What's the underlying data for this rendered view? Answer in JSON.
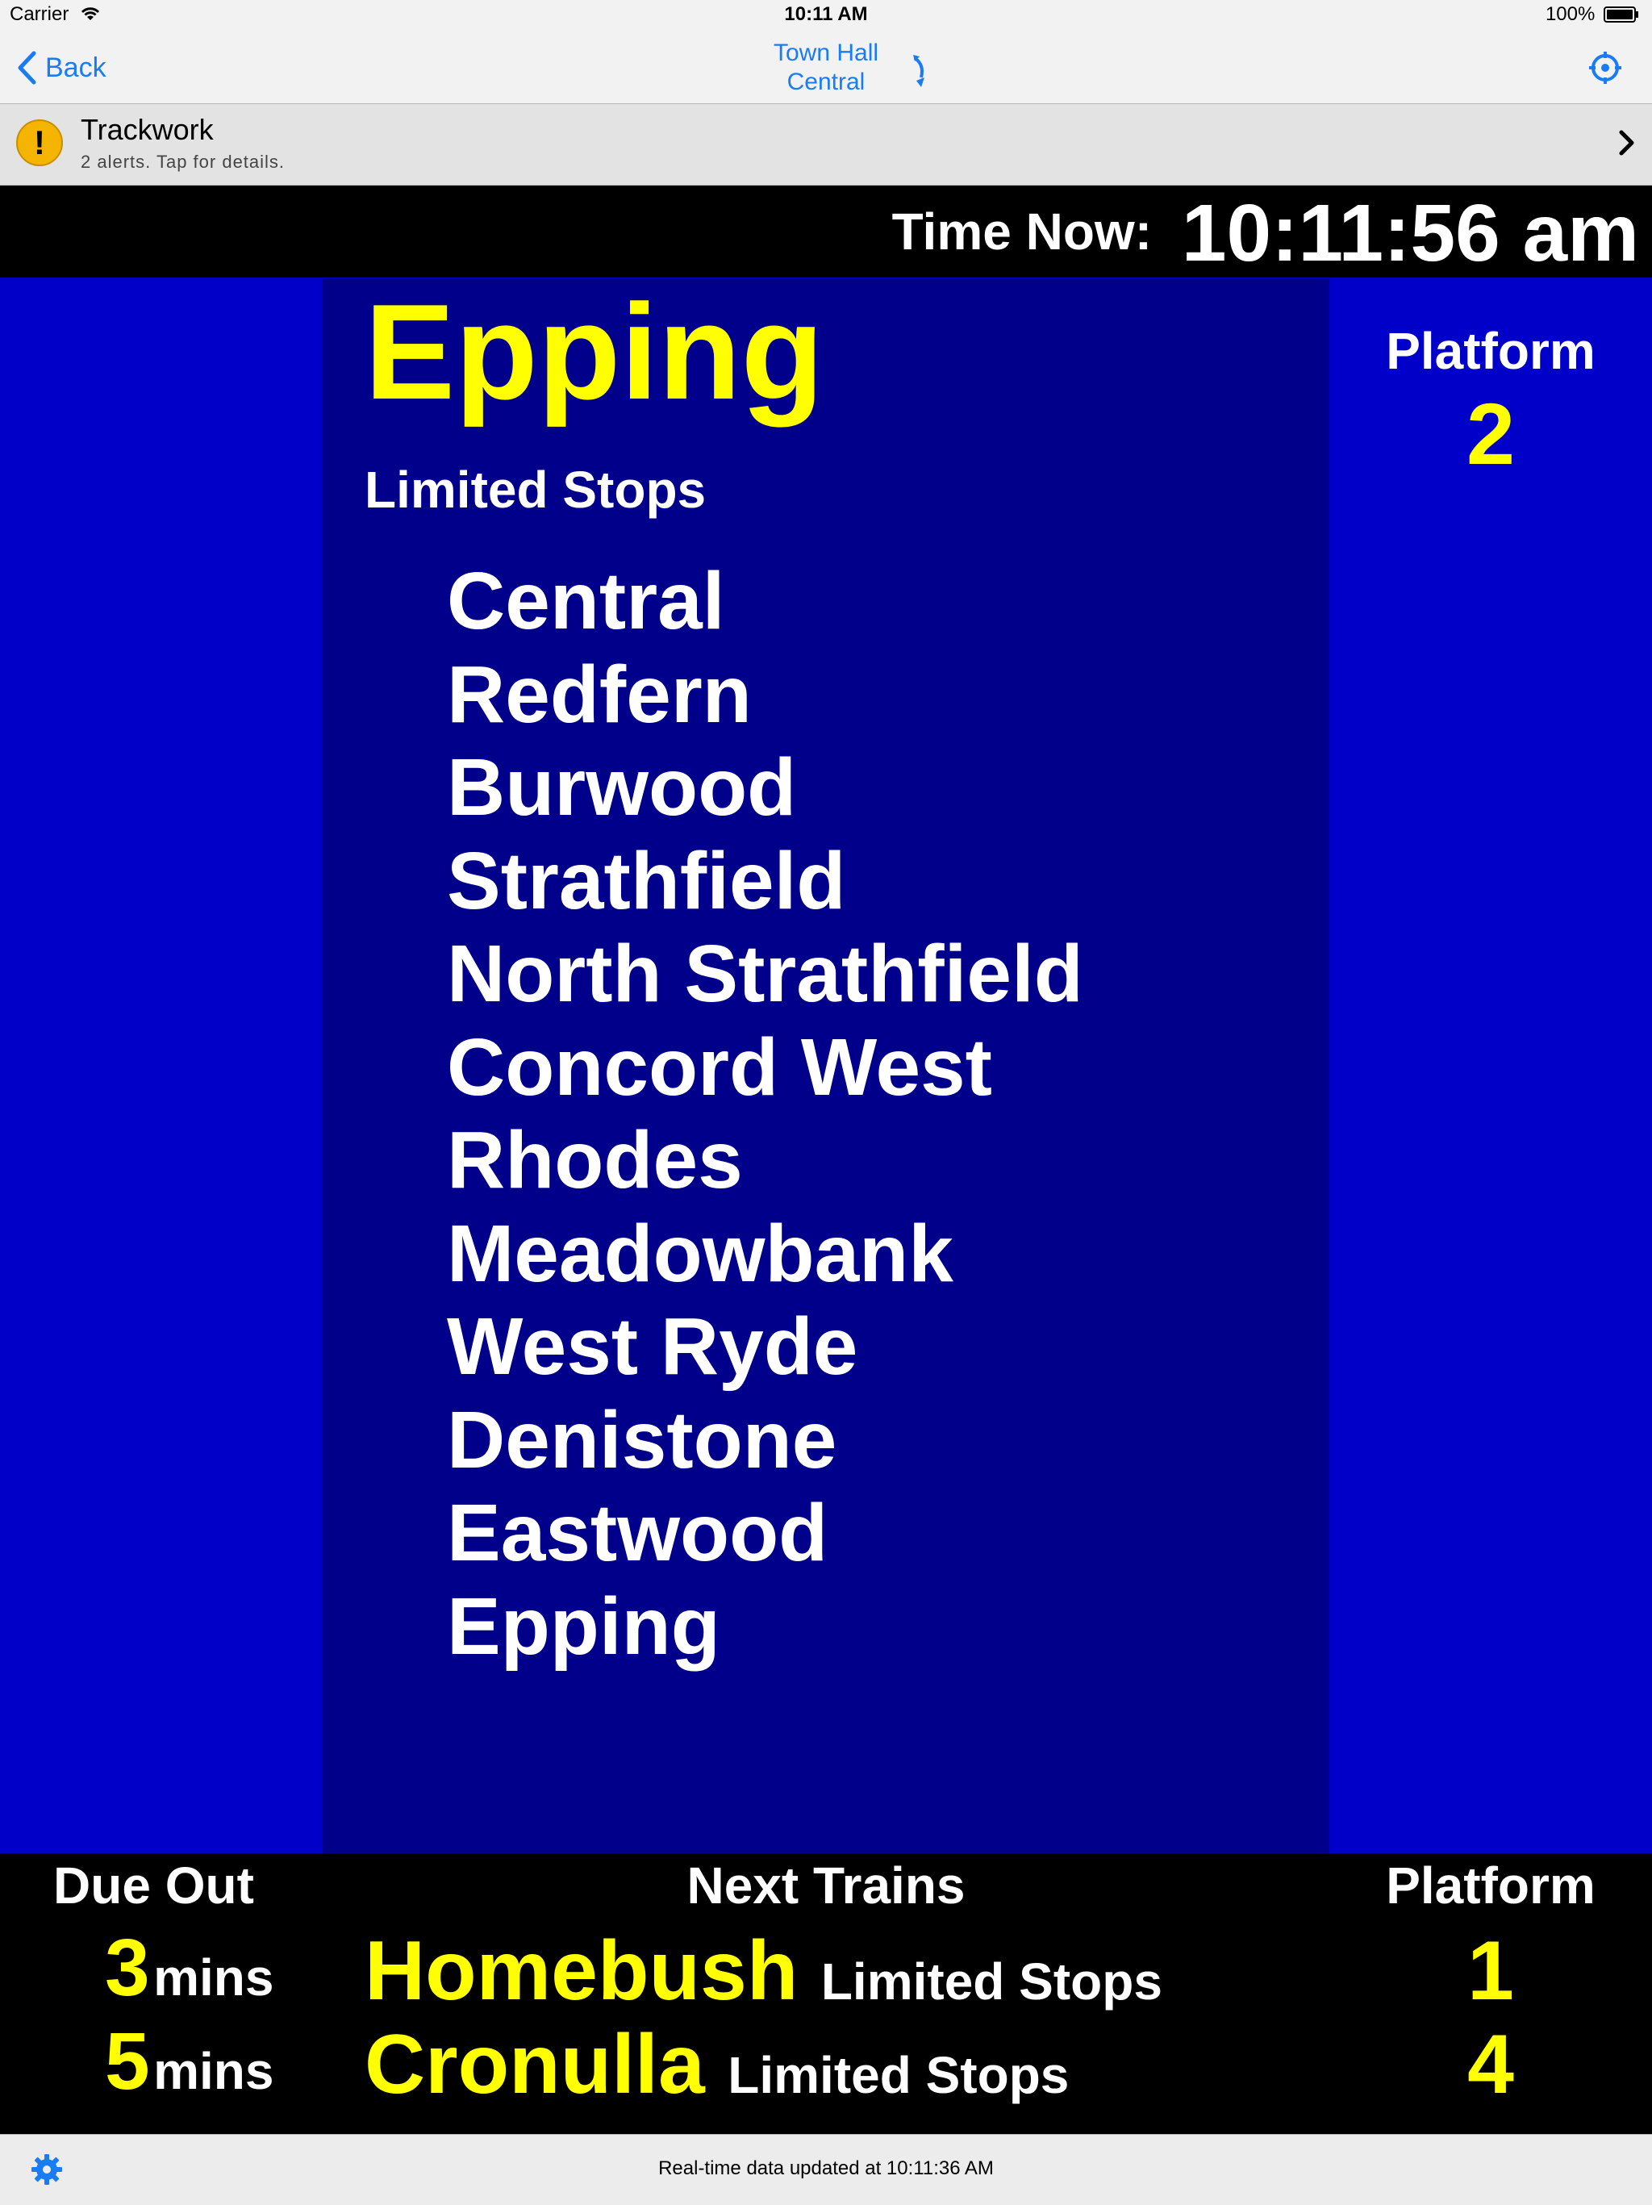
{
  "status_bar": {
    "carrier": "Carrier",
    "time": "10:11 AM",
    "battery": "100%"
  },
  "nav": {
    "back_label": "Back",
    "title_line1": "Town Hall",
    "title_line2": "Central"
  },
  "alert": {
    "title": "Trackwork",
    "subtitle": "2 alerts. Tap for details."
  },
  "clock": {
    "label": "Time Now:",
    "value": "10:11:56 am"
  },
  "departure": {
    "destination": "Epping",
    "service_type": "Limited Stops",
    "stops": [
      "Central",
      "Redfern",
      "Burwood",
      "Strathfield",
      "North Strathfield",
      "Concord West",
      "Rhodes",
      "Meadowbank",
      "West Ryde",
      "Denistone",
      "Eastwood",
      "Epping"
    ],
    "platform_label": "Platform",
    "platform": "2"
  },
  "next_trains": {
    "due_header": "Due Out",
    "next_header": "Next Trains",
    "platform_header": "Platform",
    "rows": [
      {
        "mins": "3",
        "unit": "mins",
        "destination": "Homebush",
        "service_type": "Limited Stops",
        "platform": "1"
      },
      {
        "mins": "5",
        "unit": "mins",
        "destination": "Cronulla",
        "service_type": "Limited Stops",
        "platform": "4"
      }
    ]
  },
  "footer": {
    "updated": "Real-time data updated at 10:11:36 AM"
  },
  "colors": {
    "accent": "#1a7cf5",
    "board_blue": "#0000c8",
    "panel_blue": "#00008b",
    "highlight": "#ffff00",
    "warning": "#f5b400"
  }
}
